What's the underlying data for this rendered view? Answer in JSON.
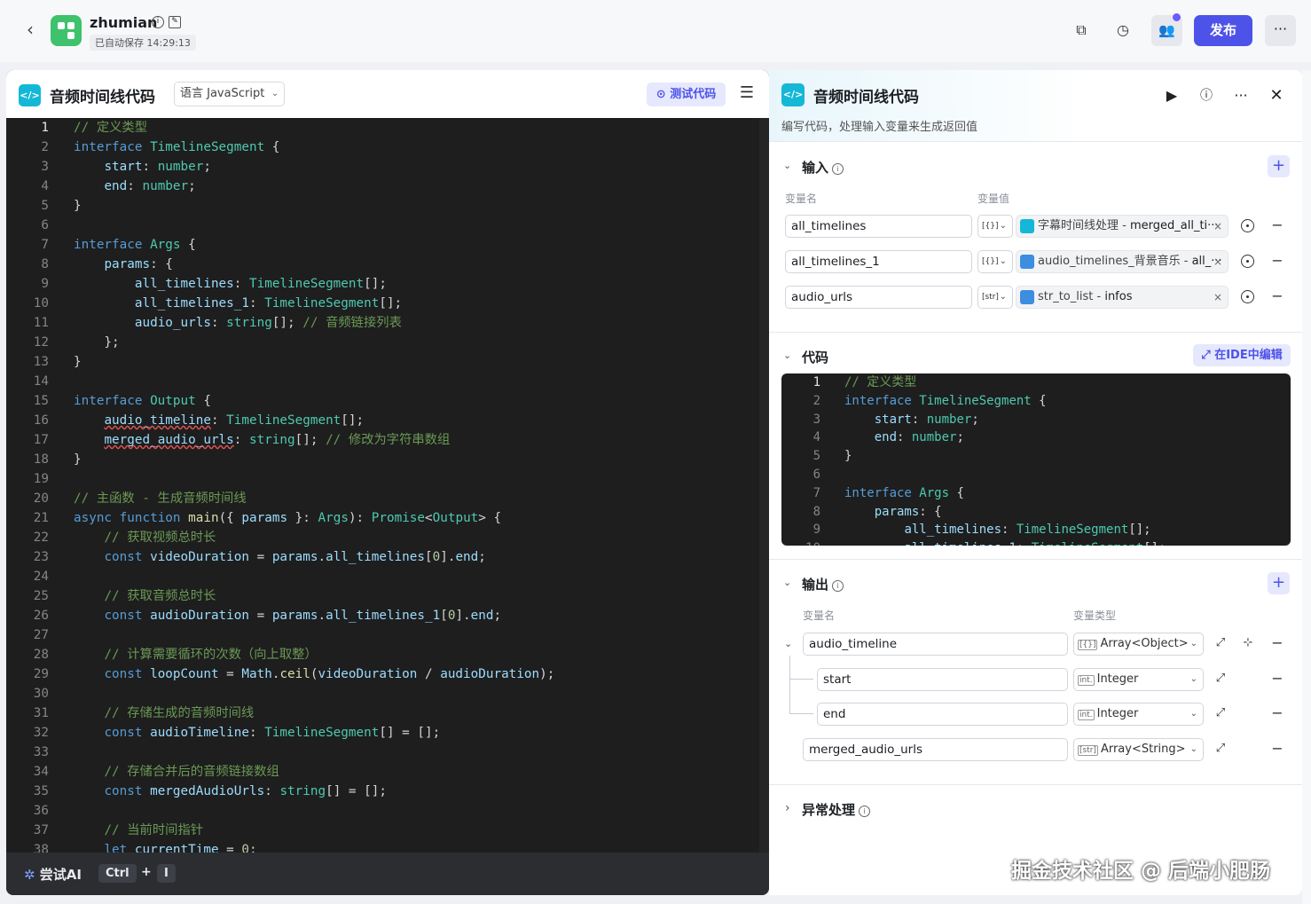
{
  "topbar": {
    "app_name": "zhumian",
    "saved_text": "已自动保存 14:29:13",
    "publish_label": "发布",
    "more_label": "···"
  },
  "editor": {
    "title": "音频时间线代码",
    "language_label": "语言 JavaScript",
    "test_label": "测试代码",
    "try_ai_label": "尝试AI",
    "kbd_ctrl": "Ctrl",
    "kbd_plus": "+",
    "kbd_i": "I",
    "active_line": 1
  },
  "code_lines": [
    [
      [
        "c",
        "// 定义类型"
      ]
    ],
    [
      [
        "k",
        "interface"
      ],
      [
        "d",
        " "
      ],
      [
        "t",
        "TimelineSegment"
      ],
      [
        "d",
        " {"
      ]
    ],
    [
      [
        "d",
        "    "
      ],
      [
        "p",
        "start"
      ],
      [
        "d",
        ": "
      ],
      [
        "t",
        "number"
      ],
      [
        "d",
        ";"
      ]
    ],
    [
      [
        "d",
        "    "
      ],
      [
        "p",
        "end"
      ],
      [
        "d",
        ": "
      ],
      [
        "t",
        "number"
      ],
      [
        "d",
        ";"
      ]
    ],
    [
      [
        "d",
        "}"
      ]
    ],
    [],
    [
      [
        "k",
        "interface"
      ],
      [
        "d",
        " "
      ],
      [
        "t",
        "Args"
      ],
      [
        "d",
        " {"
      ]
    ],
    [
      [
        "d",
        "    "
      ],
      [
        "p",
        "params"
      ],
      [
        "d",
        ": {"
      ]
    ],
    [
      [
        "d",
        "        "
      ],
      [
        "p",
        "all_timelines"
      ],
      [
        "d",
        ": "
      ],
      [
        "t",
        "TimelineSegment"
      ],
      [
        "d",
        "[];"
      ]
    ],
    [
      [
        "d",
        "        "
      ],
      [
        "p",
        "all_timelines_1"
      ],
      [
        "d",
        ": "
      ],
      [
        "t",
        "TimelineSegment"
      ],
      [
        "d",
        "[];"
      ]
    ],
    [
      [
        "d",
        "        "
      ],
      [
        "p",
        "audio_urls"
      ],
      [
        "d",
        ": "
      ],
      [
        "t",
        "string"
      ],
      [
        "d",
        "[]; "
      ],
      [
        "c",
        "// 音频链接列表"
      ]
    ],
    [
      [
        "d",
        "    };"
      ]
    ],
    [
      [
        "d",
        "}"
      ]
    ],
    [],
    [
      [
        "k",
        "interface"
      ],
      [
        "d",
        " "
      ],
      [
        "t",
        "Output"
      ],
      [
        "d",
        " {"
      ]
    ],
    [
      [
        "d",
        "    "
      ],
      [
        "pw",
        "audio_timeline"
      ],
      [
        "d",
        ": "
      ],
      [
        "t",
        "TimelineSegment"
      ],
      [
        "d",
        "[];"
      ]
    ],
    [
      [
        "d",
        "    "
      ],
      [
        "pw",
        "merged_audio_urls"
      ],
      [
        "d",
        ": "
      ],
      [
        "t",
        "string"
      ],
      [
        "d",
        "[]; "
      ],
      [
        "c",
        "// 修改为字符串数组"
      ]
    ],
    [
      [
        "d",
        "}"
      ]
    ],
    [],
    [
      [
        "c",
        "// 主函数 - 生成音频时间线"
      ]
    ],
    [
      [
        "k",
        "async"
      ],
      [
        "d",
        " "
      ],
      [
        "k",
        "function"
      ],
      [
        "d",
        " "
      ],
      [
        "f",
        "main"
      ],
      [
        "d",
        "({ "
      ],
      [
        "p",
        "params"
      ],
      [
        "d",
        " }: "
      ],
      [
        "t",
        "Args"
      ],
      [
        "d",
        "): "
      ],
      [
        "t",
        "Promise"
      ],
      [
        "d",
        "<"
      ],
      [
        "t",
        "Output"
      ],
      [
        "d",
        "> {"
      ]
    ],
    [
      [
        "d",
        "    "
      ],
      [
        "c",
        "// 获取视频总时长"
      ]
    ],
    [
      [
        "d",
        "    "
      ],
      [
        "k",
        "const"
      ],
      [
        "d",
        " "
      ],
      [
        "p",
        "videoDuration"
      ],
      [
        "d",
        " = "
      ],
      [
        "p",
        "params"
      ],
      [
        "d",
        "."
      ],
      [
        "p",
        "all_timelines"
      ],
      [
        "d",
        "["
      ],
      [
        "n",
        "0"
      ],
      [
        "d",
        "]."
      ],
      [
        "p",
        "end"
      ],
      [
        "d",
        ";"
      ]
    ],
    [],
    [
      [
        "d",
        "    "
      ],
      [
        "c",
        "// 获取音频总时长"
      ]
    ],
    [
      [
        "d",
        "    "
      ],
      [
        "k",
        "const"
      ],
      [
        "d",
        " "
      ],
      [
        "p",
        "audioDuration"
      ],
      [
        "d",
        " = "
      ],
      [
        "p",
        "params"
      ],
      [
        "d",
        "."
      ],
      [
        "p",
        "all_timelines_1"
      ],
      [
        "d",
        "["
      ],
      [
        "n",
        "0"
      ],
      [
        "d",
        "]."
      ],
      [
        "p",
        "end"
      ],
      [
        "d",
        ";"
      ]
    ],
    [],
    [
      [
        "d",
        "    "
      ],
      [
        "c",
        "// 计算需要循环的次数（向上取整）"
      ]
    ],
    [
      [
        "d",
        "    "
      ],
      [
        "k",
        "const"
      ],
      [
        "d",
        " "
      ],
      [
        "p",
        "loopCount"
      ],
      [
        "d",
        " = "
      ],
      [
        "p",
        "Math"
      ],
      [
        "d",
        "."
      ],
      [
        "f",
        "ceil"
      ],
      [
        "d",
        "("
      ],
      [
        "p",
        "videoDuration"
      ],
      [
        "d",
        " / "
      ],
      [
        "p",
        "audioDuration"
      ],
      [
        "d",
        ");"
      ]
    ],
    [],
    [
      [
        "d",
        "    "
      ],
      [
        "c",
        "// 存储生成的音频时间线"
      ]
    ],
    [
      [
        "d",
        "    "
      ],
      [
        "k",
        "const"
      ],
      [
        "d",
        " "
      ],
      [
        "p",
        "audioTimeline"
      ],
      [
        "d",
        ": "
      ],
      [
        "t",
        "TimelineSegment"
      ],
      [
        "d",
        "[] = [];"
      ]
    ],
    [],
    [
      [
        "d",
        "    "
      ],
      [
        "c",
        "// 存储合并后的音频链接数组"
      ]
    ],
    [
      [
        "d",
        "    "
      ],
      [
        "k",
        "const"
      ],
      [
        "d",
        " "
      ],
      [
        "p",
        "mergedAudioUrls"
      ],
      [
        "d",
        ": "
      ],
      [
        "t",
        "string"
      ],
      [
        "d",
        "[] = [];"
      ]
    ],
    [],
    [
      [
        "d",
        "    "
      ],
      [
        "c",
        "// 当前时间指针"
      ]
    ],
    [
      [
        "d",
        "    "
      ],
      [
        "k",
        "let"
      ],
      [
        "d",
        " "
      ],
      [
        "p",
        "currentTime"
      ],
      [
        "d",
        " = "
      ],
      [
        "n",
        "0"
      ],
      [
        "d",
        ";"
      ]
    ]
  ],
  "node": {
    "title": "音频时间线代码",
    "description": "编写代码，处理输入变量来生成返回值",
    "input_section": "输入",
    "col_var_name": "变量名",
    "col_var_value": "变量值",
    "inputs": [
      {
        "name": "all_timelines",
        "type": "[{}]",
        "ref_source": "字幕时间线处理 - ",
        "ref_var": "merged_all_ti···",
        "icon": "code-node"
      },
      {
        "name": "all_timelines_1",
        "type": "[{}]",
        "ref_source": "audio_timelines_背景音乐 - ",
        "ref_var": "all_···",
        "icon": "plugin-node"
      },
      {
        "name": "audio_urls",
        "type": "[str]",
        "ref_source": "str_to_list - ",
        "ref_var": "infos",
        "icon": "plugin-node"
      }
    ],
    "code_section": "代码",
    "ide_label": "在IDE中编辑",
    "output_section": "输出",
    "col_out_name": "变量名",
    "col_out_type": "变量类型",
    "outputs": [
      {
        "name": "audio_timeline",
        "type_badge": "[{}]",
        "type": "Array<Object>"
      },
      {
        "name": "start",
        "type_badge": "int.",
        "type": "Integer"
      },
      {
        "name": "end",
        "type_badge": "int.",
        "type": "Integer"
      },
      {
        "name": "merged_audio_urls",
        "type_badge": "[str]",
        "type": "Array<String>"
      }
    ],
    "exception_section": "异常处理"
  },
  "watermark": "掘金技术社区 @ 后端小肥肠"
}
